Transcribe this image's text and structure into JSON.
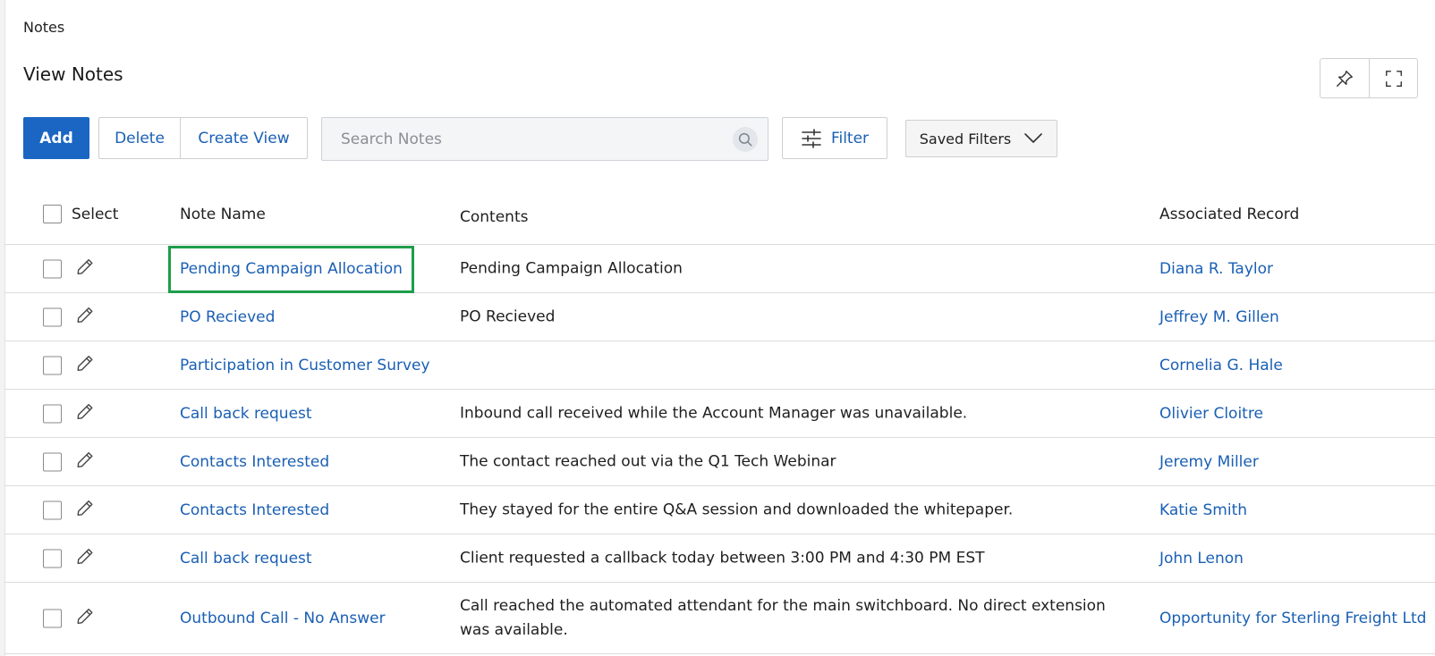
{
  "breadcrumb": "Notes",
  "page_title": "View Notes",
  "toolbar": {
    "add_label": "Add",
    "delete_label": "Delete",
    "create_view_label": "Create View",
    "search_placeholder": "Search Notes",
    "filter_label": "Filter",
    "saved_filters_label": "Saved Filters"
  },
  "table": {
    "headers": {
      "select": "Select",
      "note_name": "Note Name",
      "contents": "Contents",
      "associated_record": "Associated Record"
    },
    "rows": [
      {
        "name": "Pending Campaign Allocation",
        "contents": "Pending Campaign Allocation",
        "assoc": "Diana R. Taylor"
      },
      {
        "name": "PO Recieved",
        "contents": "PO Recieved",
        "assoc": "Jeffrey M. Gillen"
      },
      {
        "name": "Participation in Customer Survey",
        "contents": "",
        "assoc": "Cornelia G. Hale"
      },
      {
        "name": "Call back request",
        "contents": "Inbound call received while the Account Manager was unavailable.",
        "assoc": "Olivier Cloitre"
      },
      {
        "name": "Contacts Interested",
        "contents": "The contact reached out via the Q1 Tech Webinar",
        "assoc": "Jeremy Miller"
      },
      {
        "name": "Contacts Interested",
        "contents": "They stayed for the entire Q&A session and downloaded the whitepaper.",
        "assoc": "Katie Smith"
      },
      {
        "name": "Call back request",
        "contents": "Client requested a callback today between 3:00 PM and 4:30 PM EST",
        "assoc": "John Lenon"
      },
      {
        "name": "Outbound Call - No Answer",
        "contents": "Call reached the automated attendant for the main switchboard. No direct extension was available.",
        "assoc": "Opportunity for Sterling Freight Ltd"
      }
    ]
  },
  "icons": {
    "pin": "pin-icon",
    "expand": "expand-icon",
    "search": "search-icon",
    "filter": "sliders-icon",
    "saved_filters": "chevron-down-icon",
    "edit": "pencil-icon"
  },
  "colors": {
    "primary": "#1a66c2",
    "link": "#1a5fb4",
    "highlight": "#1f9d4b"
  }
}
